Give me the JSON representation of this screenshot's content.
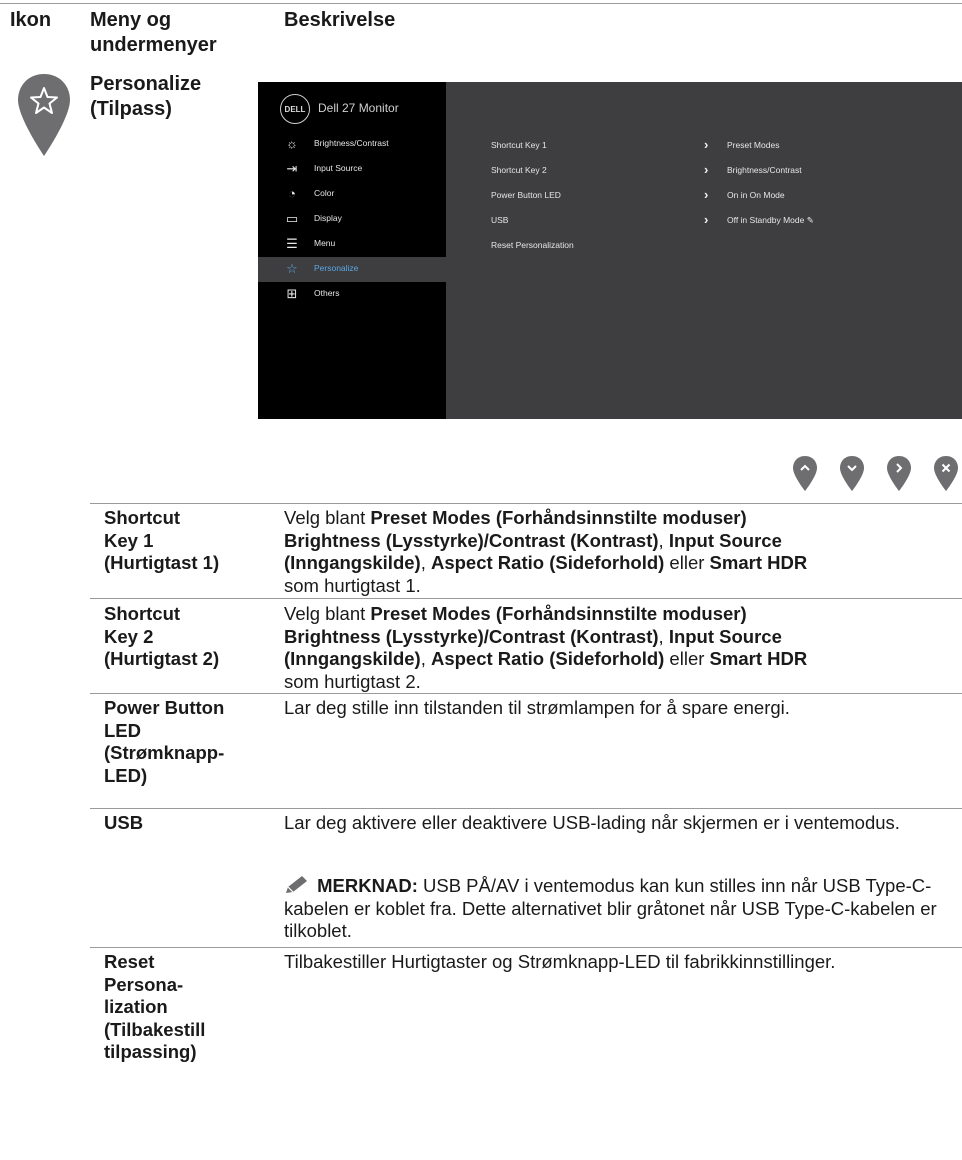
{
  "header": {
    "col_icon": "Ikon",
    "col_menu": "Meny og undermenyer",
    "col_desc": "Beskrivelse"
  },
  "menu_title": "Personalize (Tilpass)",
  "osd": {
    "logo": "DELL",
    "model": "Dell 27 Monitor",
    "items": [
      {
        "label": "Brightness/Contrast",
        "icon": "brightness-icon"
      },
      {
        "label": "Input Source",
        "icon": "input-source-icon"
      },
      {
        "label": "Color",
        "icon": "color-palette-icon"
      },
      {
        "label": "Display",
        "icon": "display-monitor-icon"
      },
      {
        "label": "Menu",
        "icon": "menu-list-icon"
      },
      {
        "label": "Personalize",
        "icon": "star-icon",
        "selected": true
      },
      {
        "label": "Others",
        "icon": "others-icon"
      }
    ],
    "rows": [
      {
        "label": "Shortcut Key 1",
        "value": "Preset Modes"
      },
      {
        "label": "Shortcut Key 2",
        "value": "Brightness/Contrast"
      },
      {
        "label": "Power Button LED",
        "value": "On in On Mode"
      },
      {
        "label": "USB",
        "value": "Off in Standby Mode"
      },
      {
        "label": "Reset Personalization",
        "value": ""
      }
    ],
    "selected_color": "#5aa7e6"
  },
  "nav_buttons": [
    "up-arrow-icon",
    "down-arrow-icon",
    "right-arrow-icon",
    "close-icon"
  ],
  "rows": [
    {
      "name": "Shortcut Key 1 (Hurtigtast 1)",
      "desc": [
        {
          "t": "Velg blant "
        },
        {
          "t": "Preset Modes (Forhåndsinnstilte moduser) Brightness (Lysstyrke)/Contrast (Kontrast)",
          "b": true
        },
        {
          "t": ", "
        },
        {
          "t": "Input Source (Inngangskilde)",
          "b": true
        },
        {
          "t": ", "
        },
        {
          "t": "Aspect Ratio (Sideforhold)",
          "b": true
        },
        {
          "t": " eller "
        },
        {
          "t": "Smart HDR",
          "b": true
        },
        {
          "t": " som hurtigtast 1."
        }
      ]
    },
    {
      "name": "Shortcut Key 2 (Hurtigtast 2)",
      "desc": [
        {
          "t": "Velg blant "
        },
        {
          "t": "Preset Modes (Forhåndsinnstilte moduser) Brightness (Lysstyrke)/Contrast (Kontrast)",
          "b": true
        },
        {
          "t": ", "
        },
        {
          "t": "Input Source (Inngangskilde)",
          "b": true
        },
        {
          "t": ", "
        },
        {
          "t": "Aspect Ratio (Sideforhold)",
          "b": true
        },
        {
          "t": " eller "
        },
        {
          "t": "Smart HDR",
          "b": true
        },
        {
          "t": " som hurtigtast 2."
        }
      ]
    },
    {
      "name": "Power Button LED (Strømknapp-LED)",
      "desc": [
        {
          "t": "Lar deg stille inn tilstanden til strømlampen for å spare energi."
        }
      ]
    },
    {
      "name": "USB",
      "desc": [
        {
          "t": "Lar deg aktivere eller deaktivere USB-lading når skjermen er i ventemodus."
        }
      ],
      "note_label": "MERKNAD:",
      "note_text": " USB PÅ/AV i ventemodus kan kun stilles inn når USB Type-C-kabelen er koblet fra. Dette alternativet blir gråtonet når USB Type-C-kabelen er tilkoblet."
    },
    {
      "name": "Reset Persona-lization (Tilbakestill tilpassing)",
      "desc": [
        {
          "t": "Tilbakestiller Hurtigtaster og Strømknapp-LED til fabrikkinnstillinger."
        }
      ]
    }
  ]
}
